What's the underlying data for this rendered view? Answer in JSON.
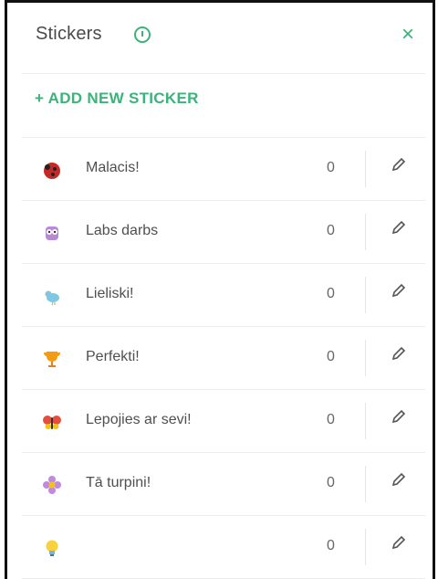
{
  "header": {
    "title": "Stickers",
    "info_icon": "info-icon",
    "close_label": "×"
  },
  "actions": {
    "add_label": "+ ADD NEW STICKER"
  },
  "colors": {
    "accent": "#3bb37a"
  },
  "stickers": [
    {
      "label": "Malacis!",
      "count": "0",
      "icon": "ladybug-icon"
    },
    {
      "label": "Labs darbs",
      "count": "0",
      "icon": "owl-icon"
    },
    {
      "label": "Lieliski!",
      "count": "0",
      "icon": "bird-icon"
    },
    {
      "label": "Perfekti!",
      "count": "0",
      "icon": "trophy-icon"
    },
    {
      "label": "Lepojies ar sevi!",
      "count": "0",
      "icon": "butterfly-icon"
    },
    {
      "label": "Tā turpini!",
      "count": "0",
      "icon": "flower-icon"
    },
    {
      "label": "",
      "count": "0",
      "icon": "lightbulb-icon"
    }
  ]
}
